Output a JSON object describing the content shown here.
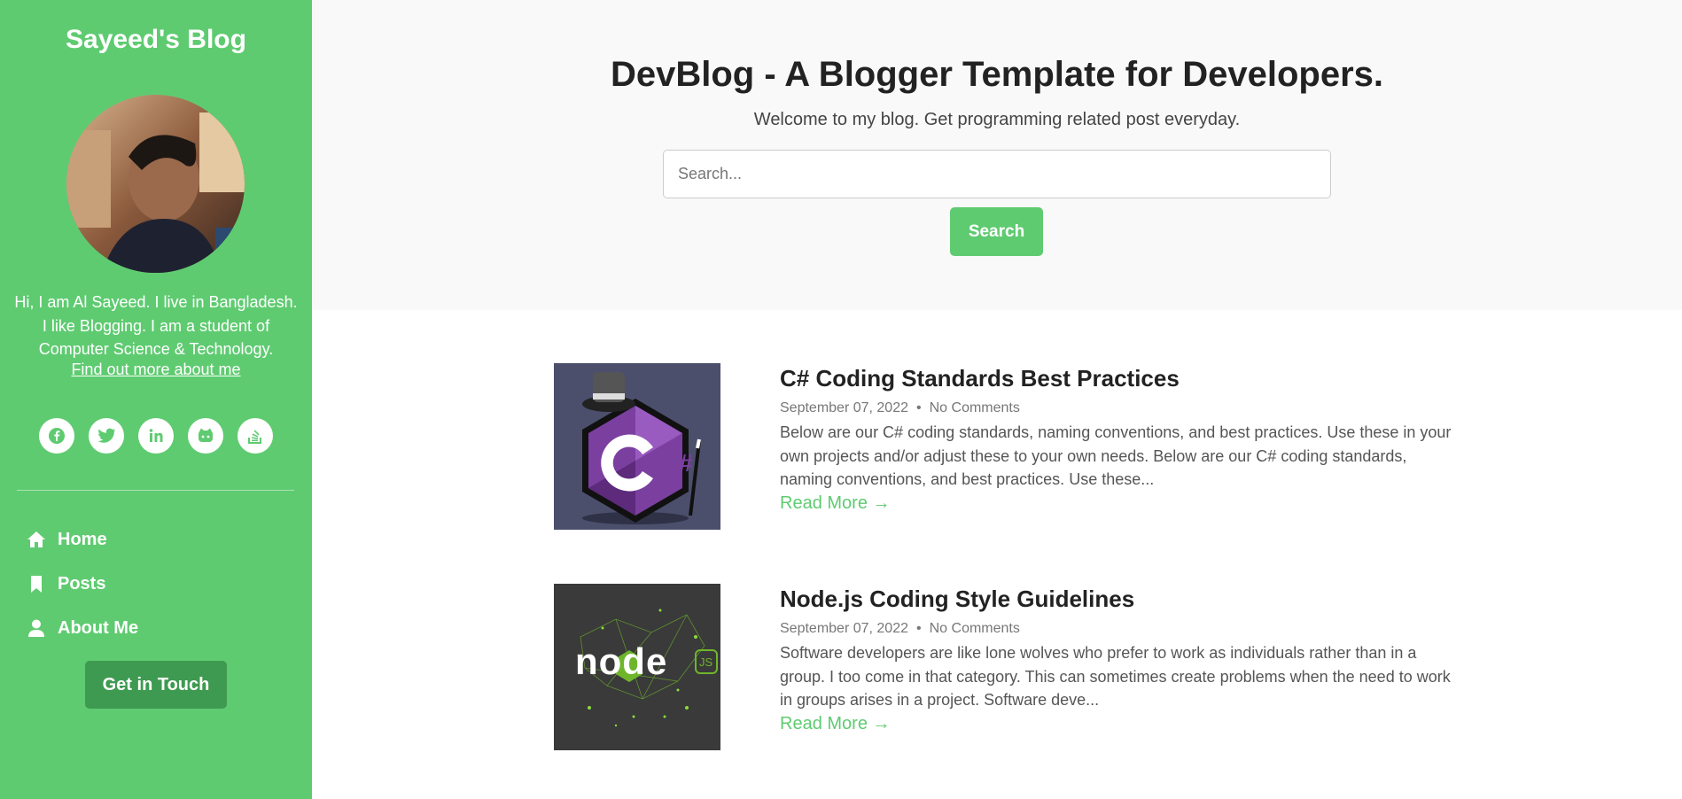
{
  "sidebar": {
    "site_title": "Sayeed's Blog",
    "bio": "Hi, I am Al Sayeed. I live in Bangladesh. I like Blogging. I am a student of Computer Science & Technology.",
    "bio_link": "Find out more about me",
    "social_icons": [
      "facebook-icon",
      "twitter-icon",
      "linkedin-icon",
      "github-icon",
      "stackoverflow-icon"
    ],
    "nav": [
      {
        "label": "Home",
        "icon": "home-icon"
      },
      {
        "label": "Posts",
        "icon": "bookmark-icon"
      },
      {
        "label": "About Me",
        "icon": "user-icon"
      }
    ],
    "cta_label": "Get in Touch"
  },
  "header": {
    "title": "DevBlog - A Blogger Template for Developers.",
    "subtitle": "Welcome to my blog. Get programming related post everyday.",
    "search_placeholder": "Search...",
    "search_button": "Search"
  },
  "posts": [
    {
      "title": "C# Coding Standards Best Practices",
      "date": "September 07, 2022",
      "comments": "No Comments",
      "excerpt": "Below are our C# coding standards, naming conventions, and best practices. Use these in your own projects and/or adjust these to your own needs. Below are our C# coding standards, naming conventions, and best practices. Use these...",
      "read_more": "Read More →",
      "thumb_text": "C#"
    },
    {
      "title": "Node.js Coding Style Guidelines",
      "date": "September 07, 2022",
      "comments": "No Comments",
      "excerpt": "Software developers are like lone wolves who prefer to work as individuals rather than in a group. I too come in that category. This can sometimes create problems when the need to work in groups arises in a project. Software deve...",
      "read_more": "Read More →",
      "thumb_text": "node",
      "thumb_badge": "JS"
    }
  ],
  "colors": {
    "accent": "#5fcb71",
    "accent_dark": "#3e9a50"
  }
}
